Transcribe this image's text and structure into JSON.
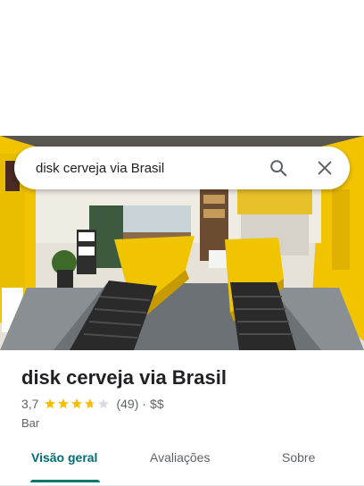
{
  "search": {
    "query": "disk cerveja via Brasil",
    "search_icon": "search-icon",
    "close_icon": "close-icon"
  },
  "place": {
    "name": "disk cerveja via Brasil",
    "rating_value": "3,7",
    "rating": 3.7,
    "reviews": "(49)",
    "separator": "·",
    "price": "$$",
    "category": "Bar"
  },
  "tabs": [
    {
      "label": "Visão geral",
      "active": true
    },
    {
      "label": "Avaliações",
      "active": false
    },
    {
      "label": "Sobre",
      "active": false
    }
  ],
  "colors": {
    "star": "#fbbc04",
    "star_empty": "#dadce0",
    "active_tab": "#006d75"
  }
}
